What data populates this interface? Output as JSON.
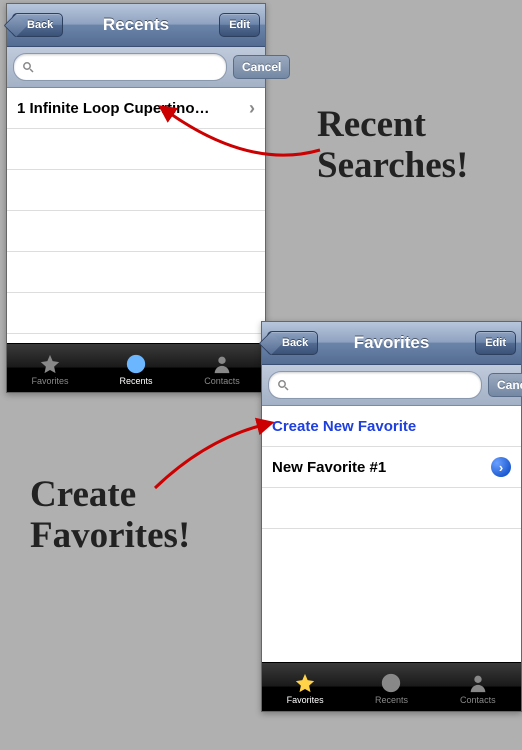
{
  "screen1": {
    "nav": {
      "back": "Back",
      "title": "Recents",
      "edit": "Edit"
    },
    "search": {
      "cancel": "Cancel",
      "placeholder": ""
    },
    "rows": [
      {
        "text": "1 Infinite Loop Cupertino…"
      }
    ],
    "tabs": {
      "favorites": "Favorites",
      "recents": "Recents",
      "contacts": "Contacts"
    }
  },
  "screen2": {
    "nav": {
      "back": "Back",
      "title": "Favorites",
      "edit": "Edit"
    },
    "search": {
      "cancel": "Cancel",
      "placeholder": ""
    },
    "rows": {
      "create": "Create New Favorite",
      "fav1": "New Favorite #1"
    },
    "tabs": {
      "favorites": "Favorites",
      "recents": "Recents",
      "contacts": "Contacts"
    }
  },
  "callouts": {
    "recent": "Recent\nSearches!",
    "create": "Create\nFavorites!"
  }
}
